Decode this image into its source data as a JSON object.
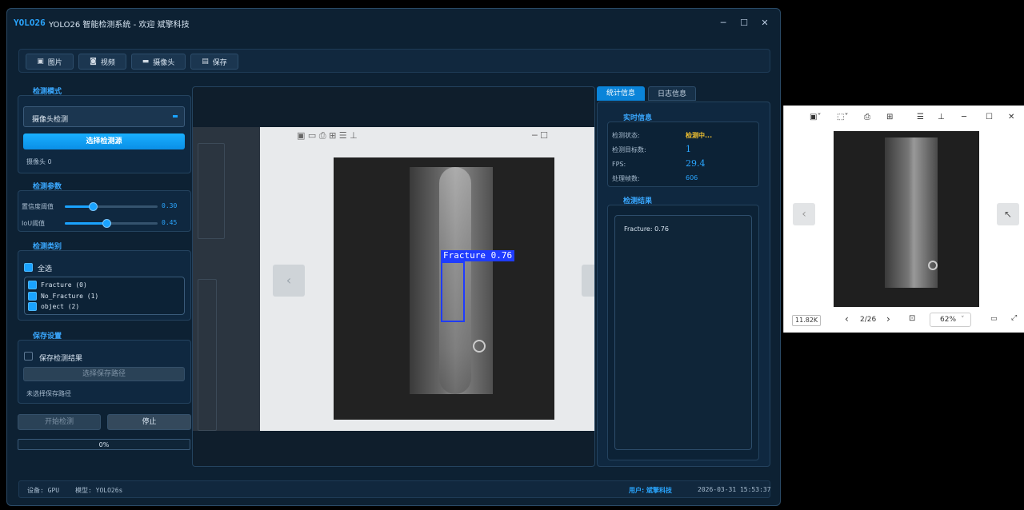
{
  "app": {
    "logo": "YOLO26",
    "title": "YOLO26 智能检测系统 - 欢迎 斌擎科技",
    "window_controls": [
      "─",
      "☐",
      "✕"
    ]
  },
  "toolbar": [
    {
      "label": "图片",
      "icon": "image-icon"
    },
    {
      "label": "视频",
      "icon": "video-icon"
    },
    {
      "label": "摄像头",
      "icon": "camera-icon"
    },
    {
      "label": "保存",
      "icon": "save-icon"
    }
  ],
  "detect_mode": {
    "title": "检测模式",
    "selected": "摄像头检测",
    "button": "选择检测源",
    "camera_label": "摄像头 0"
  },
  "params": {
    "title": "检测参数",
    "conf_label": "置信度阈值",
    "conf_value": "0.30",
    "conf_fraction": 0.3,
    "iou_label": "IoU阈值",
    "iou_value": "0.45",
    "iou_fraction": 0.45
  },
  "classes": {
    "title": "检测类别",
    "select_all": "全选",
    "items": [
      "Fracture (0)",
      "No_Fracture (1)",
      "object (2)"
    ]
  },
  "save": {
    "title": "保存设置",
    "checkbox": "保存检测结果",
    "path_button": "选择保存路径",
    "path_status": "未选择保存路径"
  },
  "actions": {
    "start": "开始检测",
    "stop": "停止",
    "progress": "0%",
    "progress_fraction": 0
  },
  "tabs": [
    "统计信息",
    "日志信息"
  ],
  "realtime": {
    "title": "实时信息",
    "rows": [
      {
        "label": "检测状态:",
        "value": "检测中..."
      },
      {
        "label": "检测目标数:",
        "value": "1"
      },
      {
        "label": "FPS:",
        "value": "29.4"
      },
      {
        "label": "处理帧数:",
        "value": "606"
      }
    ]
  },
  "results": {
    "title": "检测结果",
    "items": [
      "Fracture: 0.76"
    ]
  },
  "detection": {
    "label": "Fracture 0.76"
  },
  "status": {
    "device": "设备: GPU",
    "model": "模型: YOLO26s",
    "user": "用户: 斌擎科技",
    "time": "2026-03-31 15:53:37"
  },
  "photo_viewer": {
    "file_size": "11.82K",
    "page": "2/26",
    "zoom": "62%",
    "window_controls": [
      "─",
      "☐",
      "✕"
    ]
  },
  "colors": {
    "accent": "#1aa3ff",
    "background": "#0d2133",
    "bbox": "#1f3cff"
  }
}
